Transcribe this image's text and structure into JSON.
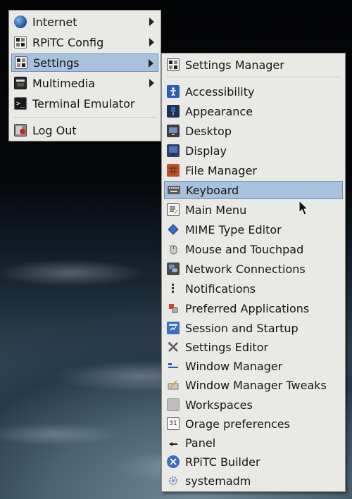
{
  "main_menu": {
    "items": [
      {
        "label": "Internet",
        "icon": "globe-icon",
        "submenu": true
      },
      {
        "label": "RPiTC Config",
        "icon": "rpitc-config-icon",
        "submenu": true
      },
      {
        "label": "Settings",
        "icon": "settings-icon",
        "submenu": true,
        "highlighted": true
      },
      {
        "label": "Multimedia",
        "icon": "multimedia-icon",
        "submenu": true
      },
      {
        "label": "Terminal Emulator",
        "icon": "terminal-icon",
        "submenu": false
      },
      {
        "label": "Log Out",
        "icon": "logout-icon",
        "submenu": false
      }
    ]
  },
  "settings_menu": {
    "items": [
      {
        "label": "Settings Manager",
        "icon": "settings-manager-icon"
      },
      {
        "label": "Accessibility",
        "icon": "accessibility-icon"
      },
      {
        "label": "Appearance",
        "icon": "appearance-icon"
      },
      {
        "label": "Desktop",
        "icon": "desktop-icon"
      },
      {
        "label": "Display",
        "icon": "display-icon"
      },
      {
        "label": "File Manager",
        "icon": "file-manager-icon"
      },
      {
        "label": "Keyboard",
        "icon": "keyboard-icon",
        "highlighted": true
      },
      {
        "label": "Main Menu",
        "icon": "main-menu-icon"
      },
      {
        "label": "MIME Type Editor",
        "icon": "mime-type-editor-icon"
      },
      {
        "label": "Mouse and Touchpad",
        "icon": "mouse-icon"
      },
      {
        "label": "Network Connections",
        "icon": "network-icon"
      },
      {
        "label": "Notifications",
        "icon": "notifications-icon"
      },
      {
        "label": "Preferred Applications",
        "icon": "preferred-applications-icon"
      },
      {
        "label": "Session and Startup",
        "icon": "session-icon"
      },
      {
        "label": "Settings Editor",
        "icon": "settings-editor-icon"
      },
      {
        "label": "Window Manager",
        "icon": "window-manager-icon"
      },
      {
        "label": "Window Manager Tweaks",
        "icon": "window-manager-tweaks-icon"
      },
      {
        "label": "Workspaces",
        "icon": "workspaces-icon"
      },
      {
        "label": "Orage preferences",
        "icon": "orage-icon"
      },
      {
        "label": "Panel",
        "icon": "panel-icon"
      },
      {
        "label": "RPiTC Builder",
        "icon": "rpitc-builder-icon"
      },
      {
        "label": "systemadm",
        "icon": "systemadm-icon"
      }
    ]
  },
  "colors": {
    "menu_bg": "#e9e9e6",
    "highlight": "#a8c2de"
  }
}
